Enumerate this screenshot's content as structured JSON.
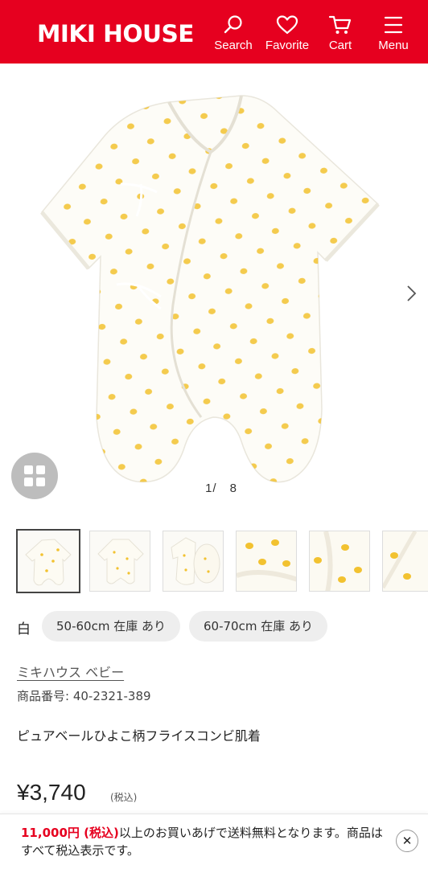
{
  "header": {
    "logo_text": "MIKI HOUSE",
    "nav": {
      "search": {
        "label": "Search",
        "icon": "search-icon"
      },
      "favorite": {
        "label": "Favorite",
        "icon": "heart-icon"
      },
      "cart": {
        "label": "Cart",
        "icon": "cart-icon"
      },
      "menu": {
        "label": "Menu",
        "icon": "hamburger-icon"
      }
    },
    "brand_color": "#e6001f"
  },
  "gallery": {
    "counter": "1/　8",
    "thumbnails": [
      "thumb-1",
      "thumb-2",
      "thumb-3",
      "thumb-4",
      "thumb-5",
      "thumb-6"
    ]
  },
  "product": {
    "color": "白",
    "sizes": [
      {
        "label": "50-60cm 在庫 あり"
      },
      {
        "label": "60-70cm 在庫 あり"
      }
    ],
    "brand": "ミキハウス ベビー",
    "number": "商品番号: 40-2321-389",
    "name": "ピュアベールひよこ柄フライスコンビ肌着",
    "price": "¥3,740",
    "tax_note": "(税込)"
  },
  "banner": {
    "amount": "11,000円 (税込)",
    "text": "以上のお買いあげで送料無料となります。商品はすべて税込表示です。",
    "close": "✕"
  }
}
